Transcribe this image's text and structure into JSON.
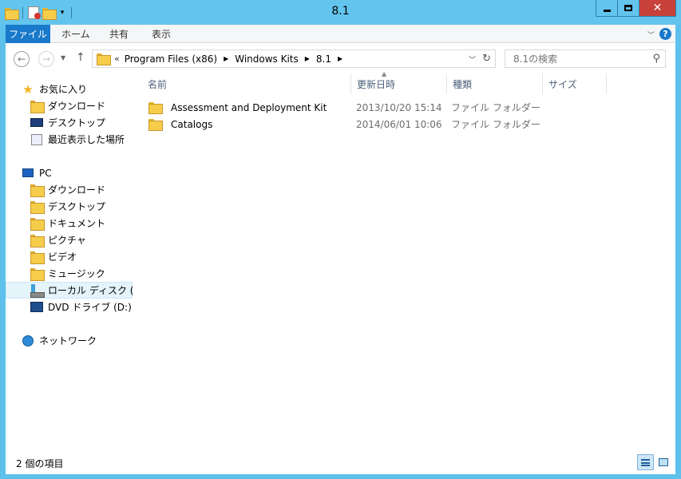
{
  "window": {
    "title": "8.1"
  },
  "ribbon": {
    "tabs": [
      {
        "label": "ファイル"
      },
      {
        "label": "ホーム"
      },
      {
        "label": "共有"
      },
      {
        "label": "表示"
      }
    ],
    "help_glyph": "?"
  },
  "address": {
    "lead": "«",
    "breadcrumbs": [
      "Program Files (x86)",
      "Windows Kits",
      "8.1"
    ]
  },
  "search": {
    "placeholder": "8.1の検索"
  },
  "nav_pane": {
    "items": [
      {
        "label": "お気に入り",
        "icon": "star-icon"
      },
      {
        "label": "ダウンロード",
        "icon": "downloads-folder-icon"
      },
      {
        "label": "デスクトップ",
        "icon": "desktop-icon"
      },
      {
        "label": "最近表示した場所",
        "icon": "recent-places-icon"
      },
      {
        "label": "PC",
        "icon": "pc-icon"
      },
      {
        "label": "ダウンロード",
        "icon": "downloads-folder-icon"
      },
      {
        "label": "デスクトップ",
        "icon": "desktop-folder-icon"
      },
      {
        "label": "ドキュメント",
        "icon": "documents-folder-icon"
      },
      {
        "label": "ピクチャ",
        "icon": "pictures-folder-icon"
      },
      {
        "label": "ビデオ",
        "icon": "videos-folder-icon"
      },
      {
        "label": "ミュージック",
        "icon": "music-folder-icon"
      },
      {
        "label": "ローカル ディスク (C:)",
        "icon": "local-disk-icon"
      },
      {
        "label": "DVD ドライブ (D:) S",
        "icon": "dvd-drive-icon"
      },
      {
        "label": "ネットワーク",
        "icon": "network-icon"
      }
    ]
  },
  "file_list": {
    "columns": [
      "名前",
      "更新日時",
      "種類",
      "サイズ"
    ],
    "rows": [
      {
        "name": "Assessment and Deployment Kit",
        "modified": "2013/10/20 15:14",
        "type": "ファイル フォルダー"
      },
      {
        "name": "Catalogs",
        "modified": "2014/06/01 10:06",
        "type": "ファイル フォルダー"
      }
    ]
  },
  "status_bar": {
    "text": "2 個の項目"
  }
}
